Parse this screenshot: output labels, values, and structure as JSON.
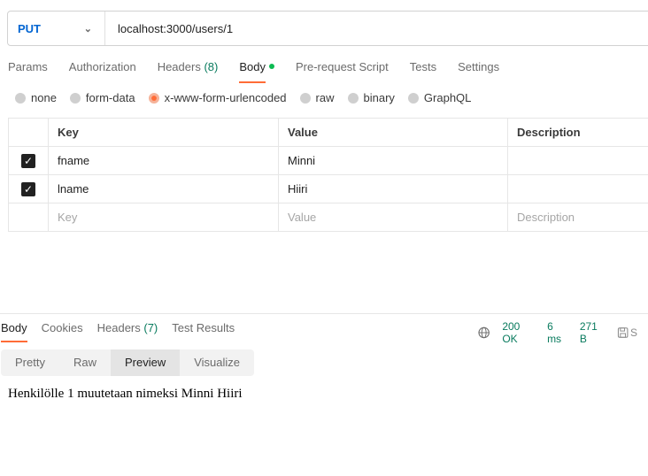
{
  "request": {
    "method": "PUT",
    "url": "localhost:3000/users/1"
  },
  "request_tabs": [
    {
      "label": "Params"
    },
    {
      "label": "Authorization"
    },
    {
      "label": "Headers",
      "count": "(8)"
    },
    {
      "label": "Body",
      "active": true
    },
    {
      "label": "Pre-request Script"
    },
    {
      "label": "Tests"
    },
    {
      "label": "Settings"
    }
  ],
  "body_types": [
    "none",
    "form-data",
    "x-www-form-urlencoded",
    "raw",
    "binary",
    "GraphQL"
  ],
  "selected_body_type": "x-www-form-urlencoded",
  "table": {
    "headers": [
      "Key",
      "Value",
      "Description"
    ],
    "rows": [
      {
        "key": "fname",
        "value": "Minni",
        "checked": true
      },
      {
        "key": "lname",
        "value": "Hiiri",
        "checked": true
      }
    ],
    "placeholders": {
      "key": "Key",
      "value": "Value",
      "description": "Description"
    }
  },
  "response_tabs": [
    {
      "label": "Body",
      "active": true
    },
    {
      "label": "Cookies"
    },
    {
      "label": "Headers",
      "count": "(7)"
    },
    {
      "label": "Test Results"
    }
  ],
  "response_meta": {
    "status": "200 OK",
    "time": "6 ms",
    "size": "271 B",
    "save_label": "S"
  },
  "view_modes": [
    "Pretty",
    "Raw",
    "Preview",
    "Visualize"
  ],
  "active_view": "Preview",
  "preview_text": "Henkilölle 1 muutetaan nimeksi Minni Hiiri",
  "colors": {
    "accent": "#ff6c37",
    "method": "#0265d2",
    "success": "#097b5e",
    "dot": "#0cbb52"
  }
}
